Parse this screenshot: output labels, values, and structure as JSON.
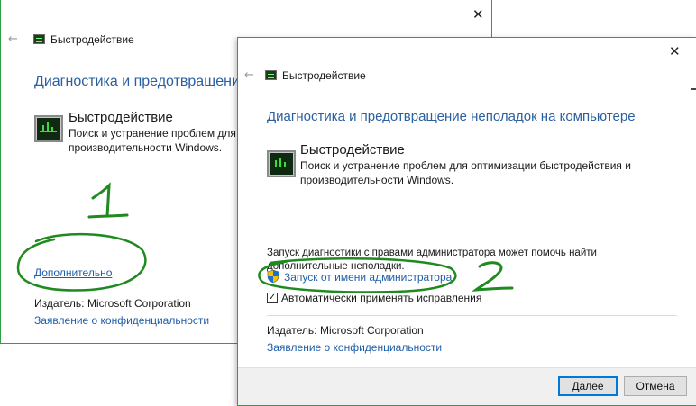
{
  "window1": {
    "title": "Быстродействие",
    "close_glyph": "✕",
    "back_glyph": "←",
    "heading": "Диагностика и предотвращение",
    "item": {
      "title": "Быстродействие",
      "description": "Поиск и устранение проблем для о производительности Windows."
    },
    "advanced_link": "Дополнительно",
    "publisher_label": "Издатель:",
    "publisher_value": "Microsoft Corporation",
    "privacy_link": "Заявление о конфиденциальности"
  },
  "window2": {
    "title": "Быстродействие",
    "close_glyph": "✕",
    "back_glyph": "←",
    "heading": "Диагностика и предотвращение неполадок на компьютере",
    "item": {
      "title": "Быстродействие",
      "description": "Поиск и устранение проблем для оптимизации быстродействия и производительности Windows."
    },
    "admin_info": "Запуск диагностики с правами администратора может помочь найти дополнительные неполадки.",
    "run_as_admin_link": "Запуск от имени администратора",
    "auto_fix_label": "Автоматически применять исправления",
    "auto_fix_checked": true,
    "checkbox_glyph": "✓",
    "publisher_label": "Издатель:",
    "publisher_value": "Microsoft Corporation",
    "privacy_link": "Заявление о конфиденциальности",
    "next_button": "Далее",
    "cancel_button": "Отмена"
  },
  "annotations": {
    "marker1": "1",
    "marker2": "2",
    "color": "#1f8a1f"
  },
  "colors": {
    "heading": "#2a5fa0",
    "link": "#1f5ea8",
    "primary_border": "#0078d7"
  }
}
